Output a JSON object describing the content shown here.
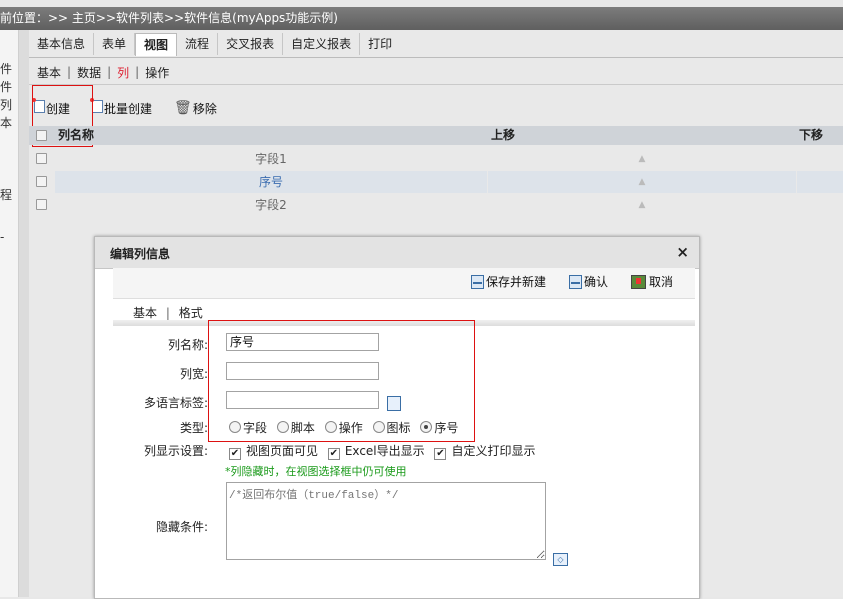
{
  "breadcrumb": "前位置：>> 主页>>软件列表>>软件信息(myApps功能示例)",
  "left_labels": [
    "件",
    "件",
    "列",
    "本",
    "程",
    "-"
  ],
  "tabs": [
    {
      "label": "基本信息"
    },
    {
      "label": "表单"
    },
    {
      "label": "视图"
    },
    {
      "label": "流程"
    },
    {
      "label": "交叉报表"
    },
    {
      "label": "自定义报表"
    },
    {
      "label": "打印"
    }
  ],
  "active_tab": "视图",
  "subtabs": [
    {
      "label": "基本"
    },
    {
      "label": "数据"
    },
    {
      "label": "列"
    },
    {
      "label": "操作"
    }
  ],
  "active_subtab": "列",
  "sep": "|",
  "toolbar": {
    "create": "创建",
    "batch_create": "批量创建",
    "remove": "移除"
  },
  "table": {
    "headers": {
      "name": "列名称",
      "up": "上移",
      "down": "下移"
    },
    "rows": [
      {
        "name": "字段1",
        "up": "▲"
      },
      {
        "name": "序号",
        "up": "▲"
      },
      {
        "name": "字段2",
        "up": "▲"
      }
    ]
  },
  "dialog": {
    "title": "编辑列信息",
    "close": "×",
    "buttons": {
      "save_new": "保存并新建",
      "confirm": "确认",
      "cancel": "取消"
    },
    "tabs": {
      "basic": "基本",
      "format": "格式"
    },
    "labels": {
      "name": "列名称:",
      "width": "列宽:",
      "i18n": "多语言标签:",
      "type": "类型:",
      "display": "列显示设置:",
      "hidden": "隐藏条件:"
    },
    "values": {
      "name": "序号",
      "width": "",
      "i18n": ""
    },
    "type_options": [
      "字段",
      "脚本",
      "操作",
      "图标",
      "序号"
    ],
    "type_selected": "序号",
    "display_options": [
      "视图页面可见",
      "Excel导出显示",
      "自定义打印显示"
    ],
    "hint": "*列隐藏时，在视图选择框中仍可使用",
    "hidden_placeholder": "/*返回布尔值（true/false）*/"
  }
}
